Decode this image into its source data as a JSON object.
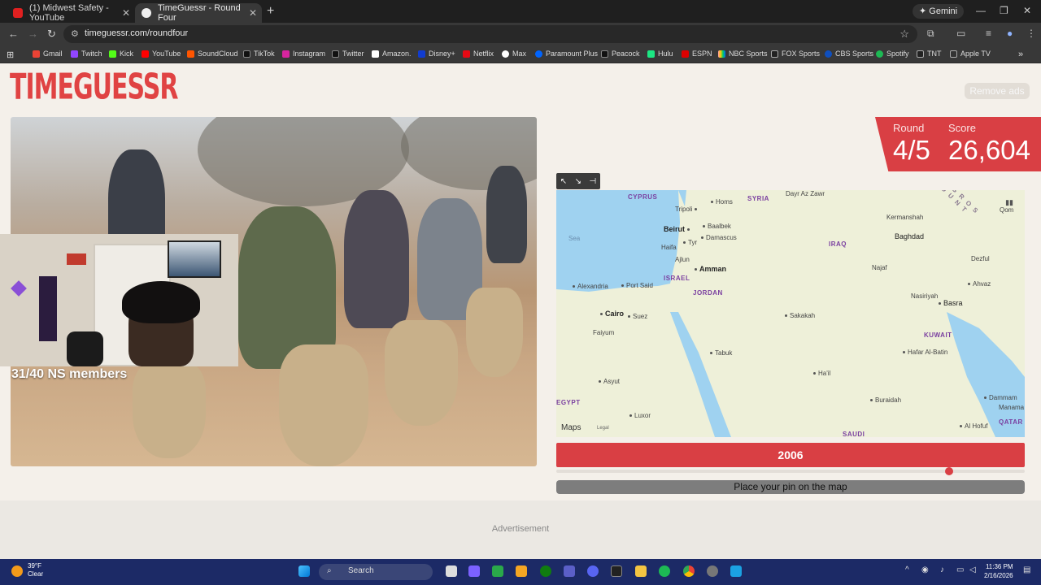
{
  "browser": {
    "tabs": [
      {
        "title": "(1) Midwest Safety - YouTube",
        "active": false
      },
      {
        "title": "TimeGuessr - Round Four",
        "active": true
      }
    ],
    "gemini_label": "Gemini",
    "url": "timeguessr.com/roundfour",
    "bookmarks": [
      "Gmail",
      "Twitch",
      "Kick",
      "YouTube",
      "SoundCloud",
      "TikTok",
      "Instagram",
      "Twitter",
      "Amazon.",
      "Disney+",
      "Netflix",
      "Max",
      "Paramount Plus",
      "Peacock",
      "Hulu",
      "ESPN",
      "NBC Sports",
      "FOX Sports",
      "CBS Sports",
      "Spotify",
      "TNT",
      "Apple TV"
    ]
  },
  "game": {
    "logo": "TIMEGUESSR",
    "remove_ads": "Remove ads",
    "overlay_text": "31/40 NS members",
    "round_label": "Round",
    "round_value": "4/5",
    "score_label": "Score",
    "score_value": "26,604",
    "year": "2006",
    "slider_fraction": 0.838,
    "pin_button": "Place your pin on the map",
    "advertisement": "Advertisement"
  },
  "map": {
    "attribution": "Maps",
    "legal": "Legal",
    "countries": [
      "CYPRUS",
      "SYRIA",
      "IRAQ",
      "ISRAEL",
      "JORDAN",
      "KUWAIT",
      "EGYPT",
      "SAUDI",
      "QATAR",
      "ZAGROS MOUNT"
    ],
    "sea_label": "Sea",
    "cities": [
      "Dayr Az Zawr",
      "Homs",
      "Tripoli",
      "Beirut",
      "Baalbek",
      "Damascus",
      "Haifa",
      "Tyr",
      "Ajlun",
      "Amman",
      "Alexandria",
      "Port Said",
      "Cairo",
      "Suez",
      "Faiyum",
      "Asyut",
      "Luxor",
      "Tabuk",
      "Sakakah",
      "Ha'il",
      "Buraidah",
      "Kermanshah",
      "Qom",
      "Baghdad",
      "Najaf",
      "Dezful",
      "Ahvaz",
      "Nasiriyah",
      "Basra",
      "Hafar Al-Batin",
      "Dammam",
      "Manama",
      "Al Hofuf"
    ]
  },
  "taskbar": {
    "temp": "39°F",
    "condition": "Clear",
    "search": "Search",
    "time": "11:36 PM",
    "date": "2/16/2026"
  }
}
